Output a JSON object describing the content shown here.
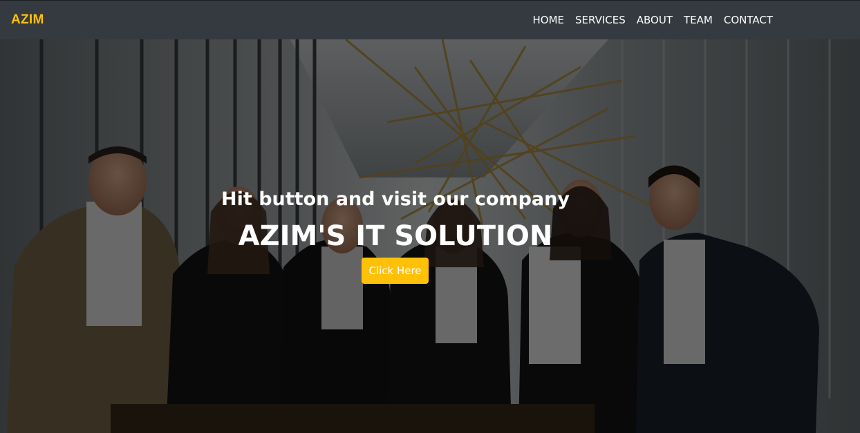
{
  "navbar": {
    "brand": "AZIM",
    "links": [
      {
        "label": "HOME"
      },
      {
        "label": "SERVICES"
      },
      {
        "label": "ABOUT"
      },
      {
        "label": "TEAM"
      },
      {
        "label": "CONTACT"
      }
    ]
  },
  "hero": {
    "subtitle": "Hit button and visit our company",
    "title": "AZIM'S IT SOLUTION",
    "button_label": "Click Here"
  },
  "colors": {
    "navbar_bg": "#343a40",
    "brand": "#ffc107",
    "button": "#ffc107",
    "text": "#ffffff"
  }
}
